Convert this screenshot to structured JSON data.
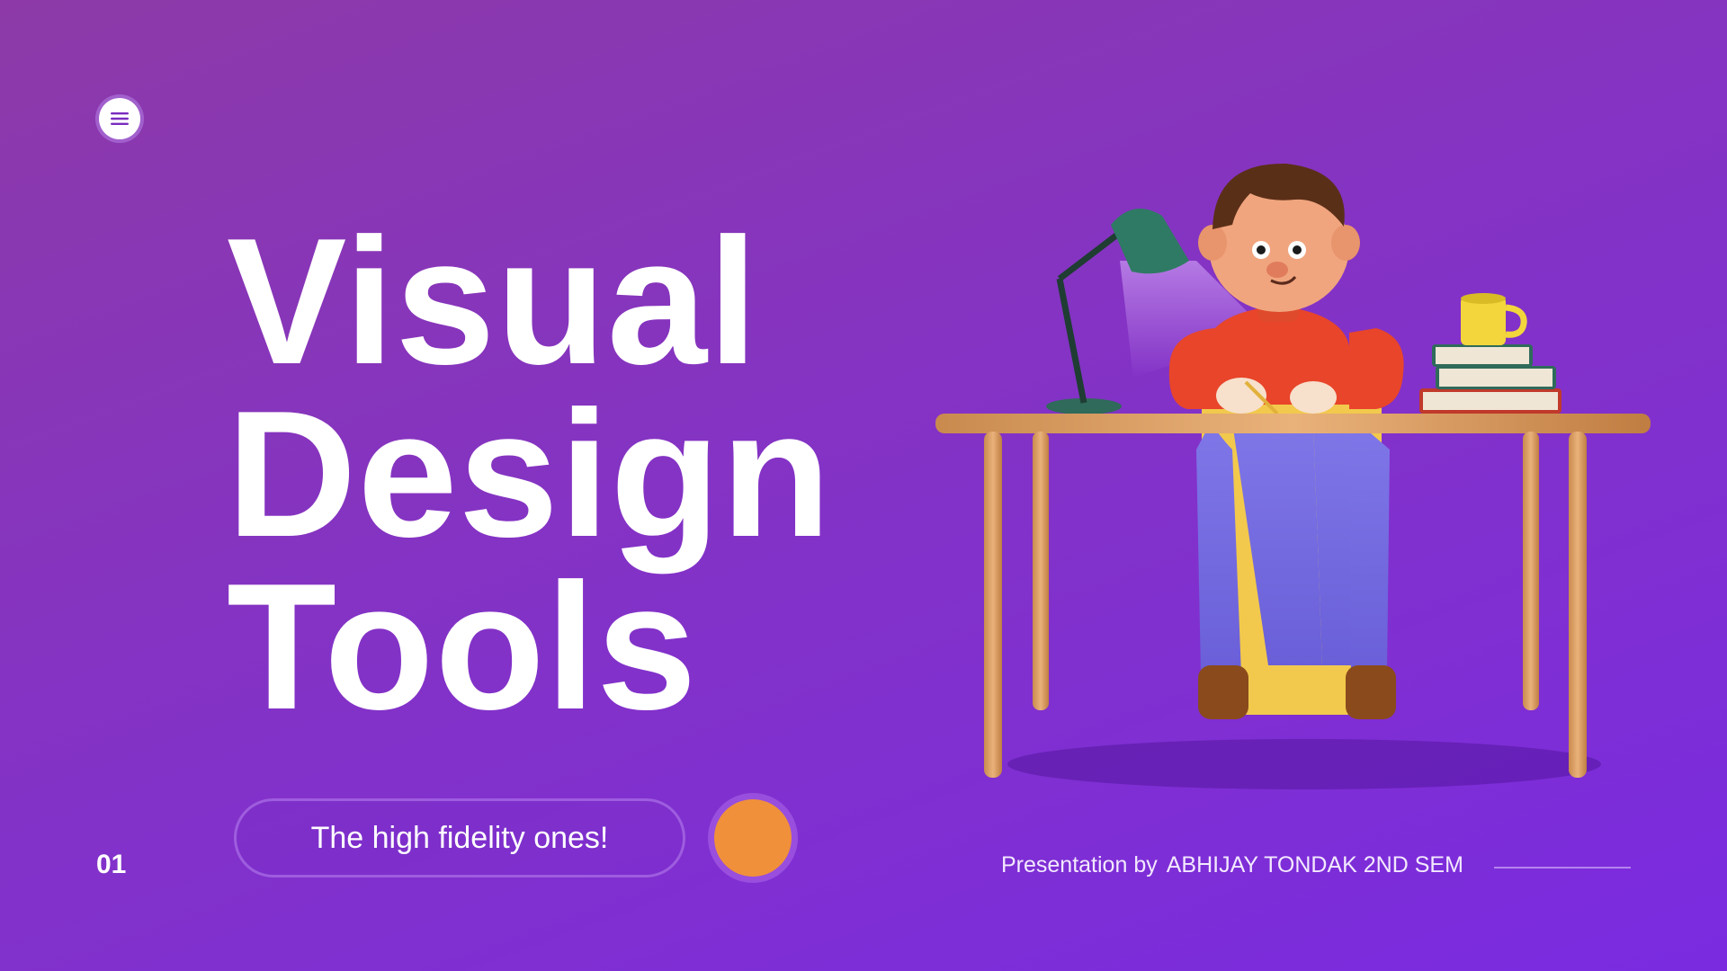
{
  "slide": {
    "title_lines": [
      "Visual",
      "Design",
      "Tools"
    ],
    "tagline": "The high fidelity ones!",
    "page_number": "01",
    "presenter_prefix": "Presentation by",
    "presenter_name": "ABHIJAY TONDAK 2ND SEM"
  },
  "icons": {
    "menu": "hamburger-menu-icon",
    "illustration": "person-at-desk-illustration"
  },
  "colors": {
    "background_start": "#8d3aa8",
    "background_end": "#7a2be0",
    "accent_orange": "#f0903a",
    "text": "#ffffff"
  }
}
